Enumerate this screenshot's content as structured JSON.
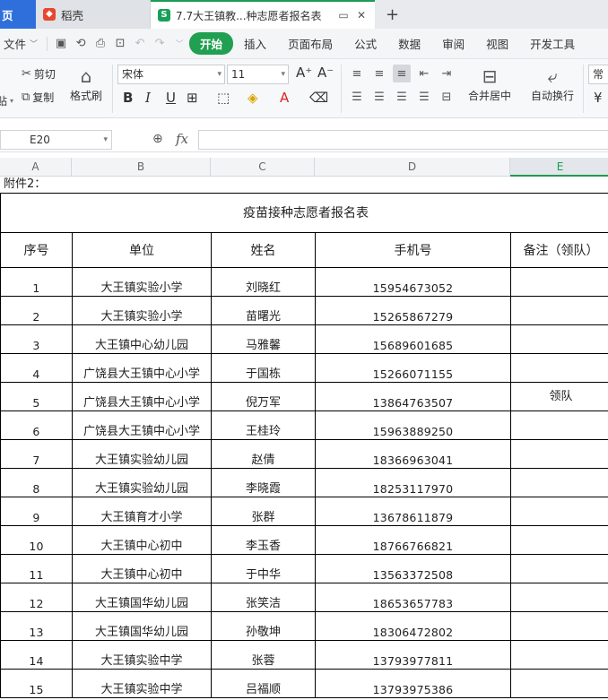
{
  "tabs": {
    "home": "页",
    "docer": "稻壳",
    "active_title": "7.7大王镇教...种志愿者报名表",
    "plus": "+"
  },
  "menu": {
    "file": "文件",
    "tabs": [
      "开始",
      "插入",
      "页面布局",
      "公式",
      "数据",
      "审阅",
      "视图",
      "开发工具"
    ]
  },
  "ribbon": {
    "paste": "贴",
    "cut": "剪切",
    "copy": "复制",
    "format_painter": "格式刷",
    "font_name": "宋体",
    "font_size": "11",
    "merge_center": "合并居中",
    "wrap_text": "自动换行",
    "number_format": "常规"
  },
  "formula_bar": {
    "name_box": "E20",
    "formula": ""
  },
  "columns": [
    {
      "label": "A"
    },
    {
      "label": "B"
    },
    {
      "label": "C"
    },
    {
      "label": "D"
    },
    {
      "label": "E"
    }
  ],
  "sheet": {
    "attachment_label": "附件2：",
    "title": "疫苗接种志愿者报名表",
    "headers": [
      "序号",
      "单位",
      "姓名",
      "手机号",
      "备注（领队）"
    ],
    "rows": [
      {
        "no": "1",
        "unit": "大王镇实验小学",
        "name": "刘晓红",
        "phone": "15954673052",
        "note": ""
      },
      {
        "no": "2",
        "unit": "大王镇实验小学",
        "name": "苗曙光",
        "phone": "15265867279",
        "note": ""
      },
      {
        "no": "3",
        "unit": "大王镇中心幼儿园",
        "name": "马雅馨",
        "phone": "15689601685",
        "note": ""
      },
      {
        "no": "4",
        "unit": "广饶县大王镇中心小学",
        "name": "于国栋",
        "phone": "15266071155",
        "note": ""
      },
      {
        "no": "5",
        "unit": "广饶县大王镇中心小学",
        "name": "倪万军",
        "phone": "13864763507",
        "note": "领队"
      },
      {
        "no": "6",
        "unit": "广饶县大王镇中心小学",
        "name": "王桂玲",
        "phone": "15963889250",
        "note": ""
      },
      {
        "no": "7",
        "unit": "大王镇实验幼儿园",
        "name": "赵倩",
        "phone": "18366963041",
        "note": ""
      },
      {
        "no": "8",
        "unit": "大王镇实验幼儿园",
        "name": "李晓霞",
        "phone": "18253117970",
        "note": ""
      },
      {
        "no": "9",
        "unit": "大王镇育才小学",
        "name": "张群",
        "phone": "13678611879",
        "note": ""
      },
      {
        "no": "10",
        "unit": "大王镇中心初中",
        "name": "李玉香",
        "phone": "18766766821",
        "note": ""
      },
      {
        "no": "11",
        "unit": "大王镇中心初中",
        "name": "于中华",
        "phone": "13563372508",
        "note": ""
      },
      {
        "no": "12",
        "unit": "大王镇国华幼儿园",
        "name": "张笑洁",
        "phone": "18653657783",
        "note": ""
      },
      {
        "no": "13",
        "unit": "大王镇国华幼儿园",
        "name": "孙敬坤",
        "phone": "18306472802",
        "note": ""
      },
      {
        "no": "14",
        "unit": "大王镇实验中学",
        "name": "张蓉",
        "phone": "13793977811",
        "note": ""
      },
      {
        "no": "15",
        "unit": "大王镇实验中学",
        "name": "吕福顺",
        "phone": "13793975386",
        "note": ""
      }
    ]
  },
  "colors": {
    "accent_green": "#20a050",
    "home_tab_blue": "#2f6fdb"
  }
}
